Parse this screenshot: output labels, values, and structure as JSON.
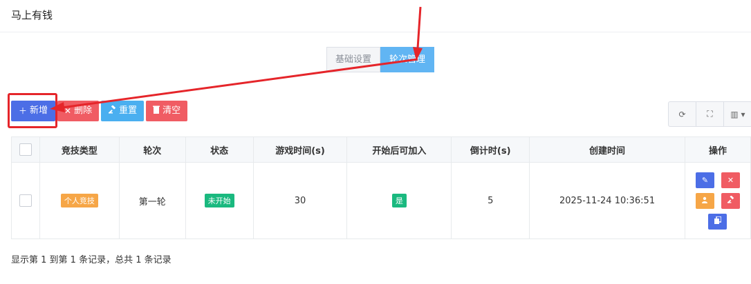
{
  "app": {
    "title": "马上有钱"
  },
  "tabs": [
    {
      "label": "基础设置",
      "active": false
    },
    {
      "label": "轮次管理",
      "active": true
    }
  ],
  "toolbar": {
    "add_label": "新增",
    "delete_label": "删除",
    "reset_label": "重置",
    "clear_label": "清空",
    "add_icon": "plus-icon",
    "delete_icon": "close-icon",
    "reset_icon": "gavel-icon",
    "clear_icon": "trash-icon",
    "right_icons": [
      "refresh-icon",
      "fullscreen-icon",
      "columns-icon"
    ]
  },
  "table": {
    "headers": [
      "竞技类型",
      "轮次",
      "状态",
      "游戏时间(s)",
      "开始后可加入",
      "倒计时(s)",
      "创建时间",
      "操作"
    ],
    "rows": [
      {
        "type": "个人竞技",
        "round": "第一轮",
        "status": "未开始",
        "game_time": "30",
        "joinable": "是",
        "countdown": "5",
        "created": "2025-11-24 10:36:51"
      }
    ],
    "row_actions": [
      "edit-icon",
      "delete-icon",
      "user-icon",
      "gavel-icon",
      "copy-icon"
    ]
  },
  "footer": {
    "info": "显示第 1 到第 1 条记录，总共 1 条记录"
  },
  "colors": {
    "primary": "#4c6ee6",
    "danger": "#f05c63",
    "info": "#4aaff0",
    "warning": "#f6a647",
    "success": "#1ab97f",
    "tab_active": "#61b5f3",
    "annotation": "#e5252a"
  }
}
